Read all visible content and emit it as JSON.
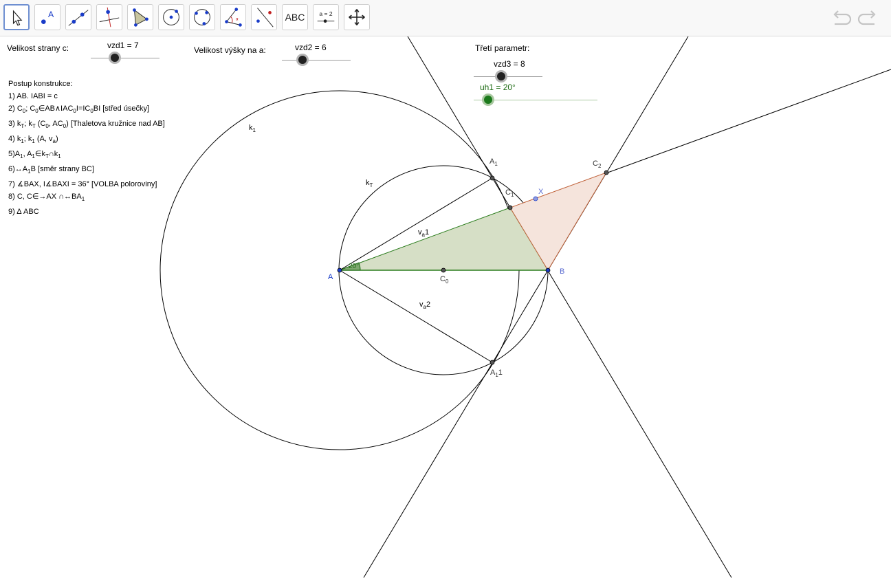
{
  "toolbar": {
    "tools": [
      {
        "name": "move-tool-icon"
      },
      {
        "name": "point-tool-icon",
        "letter": "A"
      },
      {
        "name": "line-tool-icon"
      },
      {
        "name": "perpendicular-line-tool-icon"
      },
      {
        "name": "polygon-tool-icon"
      },
      {
        "name": "circle-center-point-tool-icon"
      },
      {
        "name": "circle-three-points-tool-icon"
      },
      {
        "name": "angle-tool-icon"
      },
      {
        "name": "reflect-tool-icon"
      },
      {
        "name": "text-tool-icon",
        "label": "ABC"
      },
      {
        "name": "slider-tool-icon",
        "label": "a = 2"
      },
      {
        "name": "move-graphics-view-tool-icon"
      }
    ],
    "undo_icon": "undo-icon",
    "redo_icon": "redo-icon"
  },
  "sliders": {
    "c": {
      "caption": "Velikost strany c:",
      "label": "vzd1 = 7",
      "value": 7
    },
    "va": {
      "caption": "Velikost výšky na a:",
      "label": "vzd2 = 6",
      "value": 6
    },
    "third": {
      "caption": "Třetí parametr:",
      "label": "vzd3 = 8",
      "value": 8
    },
    "angle": {
      "label": "uh1 = 20°",
      "value": 20
    }
  },
  "steps": {
    "title": "Postup konstrukce:",
    "s1": "1) AB. IABI = c",
    "s2a": "2) C",
    "s2b": "; C",
    "s2c": "∈AB∧IAC",
    "s2d": "I=IC",
    "s2e": "BI   [střed úsečky]",
    "s3a": "3) k",
    "s3b": "; k",
    "s3c": " (C",
    "s3d": ", AC",
    "s3e": ")    [Thaletova kružnice nad AB]",
    "s4a": "4) k",
    "s4b": "; k",
    "s4c": " (A, v",
    "s4d": ")",
    "s5a": "5)A",
    "s5b": ", A",
    "s5c": "∈k",
    "s5d": "∩k",
    "s6a": "6)↔A",
    "s6b": "B                      [směr strany BC]",
    "s7": "7) ∡BAX, I∡BAXI = 36°   [VOLBA poloroviny]",
    "s8a": "8) C, C∈→AX ∩↔BA",
    "s9": "9) Δ ABC",
    "sub0": "0",
    "subT": "T",
    "sub1": "1",
    "subA": "a"
  },
  "labels": {
    "A": "A",
    "B": "B",
    "C": "C",
    "C0sub": "0",
    "A1": "A",
    "A1sub": "1",
    "A11": "A",
    "A11sub": "1",
    "A11tail": "1",
    "C1": "C",
    "C1sub": "1",
    "C2": "C",
    "C2sub": "2",
    "X": "X",
    "k1": "k",
    "k1sub": "1",
    "kT": "k",
    "kTsub": "T",
    "va1": "v",
    "va1sub": "a",
    "va1tail": "1",
    "va2": "v",
    "va2sub": "a",
    "va2tail": "2",
    "angle": "20°"
  },
  "colors": {
    "triangle_fill": "#d6dfc6",
    "triangle_edge": "#2a7d1c",
    "triangle2_fill": "#f5e4dc",
    "triangle2_edge": "#c0623a",
    "point_blue": "#1a3cc8",
    "angle_green": "#1c6a12"
  }
}
